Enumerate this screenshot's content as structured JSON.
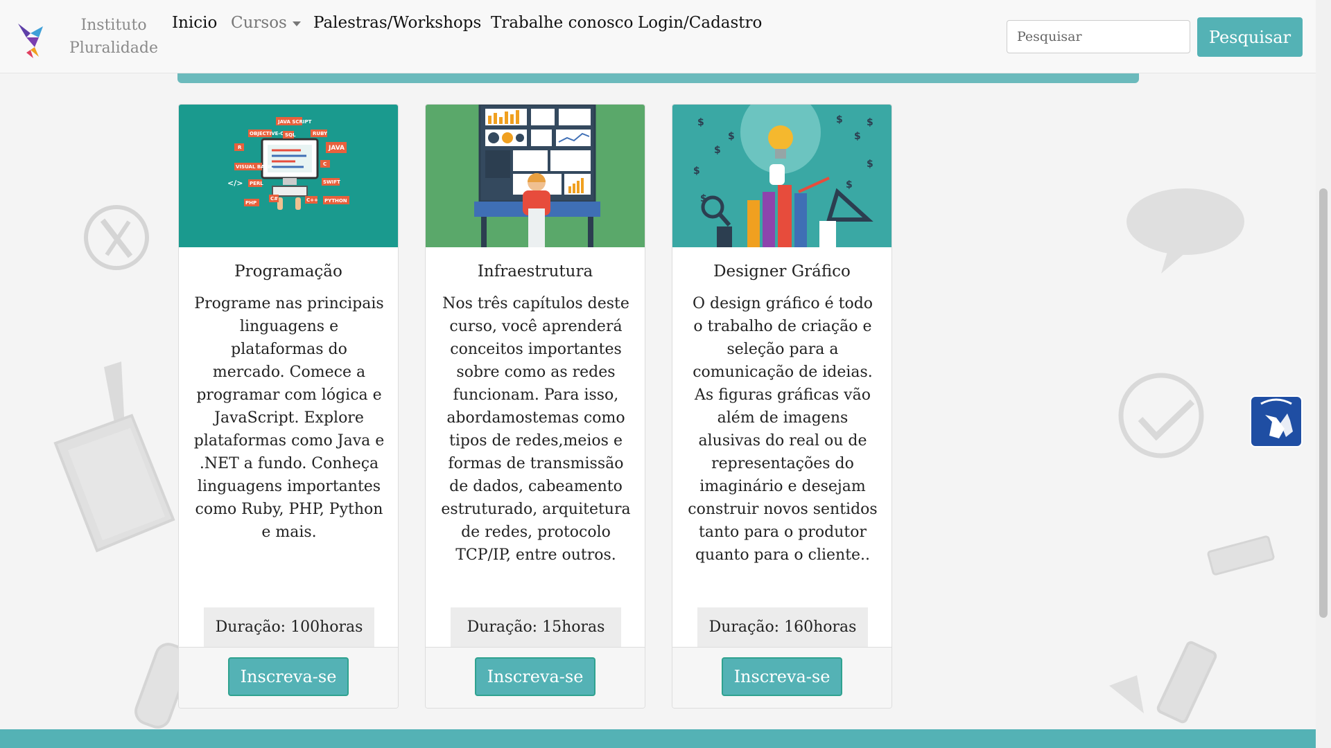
{
  "brand": {
    "line1": "Instituto",
    "line2": "Pluralidade",
    "logo_icon": "hummingbird-logo"
  },
  "nav": {
    "items": [
      {
        "label": "Inicio"
      },
      {
        "label": "Cursos",
        "has_dropdown": true
      },
      {
        "label": "Palestras/Workshops"
      },
      {
        "label": "Trabalhe conosco"
      },
      {
        "label": "Login/Cadastro"
      }
    ]
  },
  "search": {
    "placeholder": "Pesquisar",
    "button_label": "Pesquisar"
  },
  "cards": [
    {
      "title": "Programação",
      "text": "Programe nas principais linguagens e plataformas do mercado. Comece a programar com lógica e JavaScript. Explore plataformas como Java e .NET a fundo. Conheça linguagens importantes como Ruby, PHP, Python e mais.",
      "duration": "Duração: 100horas",
      "button": "Inscreva-se",
      "image_icon": "programming-illustration",
      "image_labels": [
        "JAVA SCRIPT",
        "OBJECTIVE-C",
        "SQL",
        "RUBY",
        "R",
        "JAVA",
        "C",
        "VISUAL BASIC",
        "SWIFT",
        "PERL",
        "C#",
        "C++",
        "PHP",
        "PYTHON"
      ]
    },
    {
      "title": "Infraestrutura",
      "text": "Nos três capítulos deste curso, você aprenderá conceitos importantes sobre como as redes funcionam. Para isso, abordamostemas como tipos de redes,meios e formas de transmissão de dados, cabeamento estruturado, arquitetura de redes, protocolo TCP/IP, entre outros.",
      "duration": "Duração: 15horas",
      "button": "Inscreva-se",
      "image_icon": "control-room-illustration"
    },
    {
      "title": "Designer Gráfico",
      "text": "O design gráfico é todo o trabalho de criação e seleção para a comunicação de ideias. As figuras gráficas vão além de imagens alusivas do real ou de representações do imaginário e desejam construir novos sentidos tanto para o produtor quanto para o cliente..",
      "duration": "Duração: 160horas",
      "button": "Inscreva-se",
      "image_icon": "design-tools-illustration"
    }
  ],
  "accessibility": {
    "icon": "sign-language-hands-icon"
  },
  "colors": {
    "accent": "#54b2b5",
    "card1_bg": "#1a9a8e",
    "card2_bg": "#5aa86a",
    "card3_bg": "#3aa8a4",
    "access_btn": "#1f4ea3"
  }
}
